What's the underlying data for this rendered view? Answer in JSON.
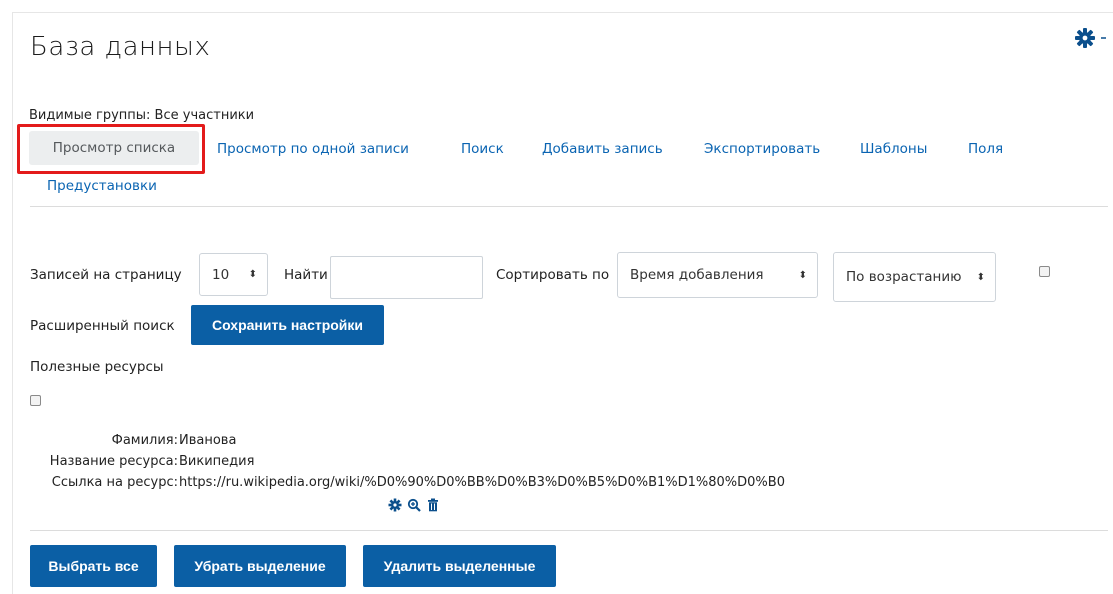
{
  "header": {
    "title": "База данных"
  },
  "settings_menu": {
    "icon": "gear-icon"
  },
  "groups": {
    "text": "Видимые группы: Все участники"
  },
  "tabs": [
    {
      "label": "Просмотр списка",
      "active": true
    },
    {
      "label": "Просмотр по одной записи"
    },
    {
      "label": "Поиск"
    },
    {
      "label": "Добавить запись"
    },
    {
      "label": "Экспортировать"
    },
    {
      "label": "Шаблоны"
    },
    {
      "label": "Поля"
    },
    {
      "label": "Предустановки"
    }
  ],
  "filters": {
    "per_page_label": "Записей на страницу",
    "per_page_value": "10",
    "find_label": "Найти",
    "find_value": "",
    "sort_label": "Сортировать по",
    "sort_value": "Время добавления",
    "order_value": "По возрастанию",
    "advanced_label": "Расширенный поиск",
    "save_button": "Сохранить настройки"
  },
  "section": {
    "title": "Полезные ресурсы"
  },
  "entry": {
    "fields": [
      {
        "name": "Фамилия:",
        "value": "Иванова"
      },
      {
        "name": "Название ресурса:",
        "value": "Википедия"
      },
      {
        "name": "Ссылка на ресурс:",
        "value": "https://ru.wikipedia.org/wiki/%D0%90%D0%BB%D0%B3%D0%B5%D0%B1%D1%80%D0%B0"
      }
    ],
    "actions": [
      "gear-icon",
      "zoom-icon",
      "trash-icon"
    ]
  },
  "bulk": {
    "select_all": "Выбрать все",
    "deselect": "Убрать выделение",
    "delete_selected": "Удалить выделенные"
  },
  "colors": {
    "link": "#0a64b2",
    "primary_button": "#0b5fa5",
    "highlight": "#e31b1b"
  }
}
